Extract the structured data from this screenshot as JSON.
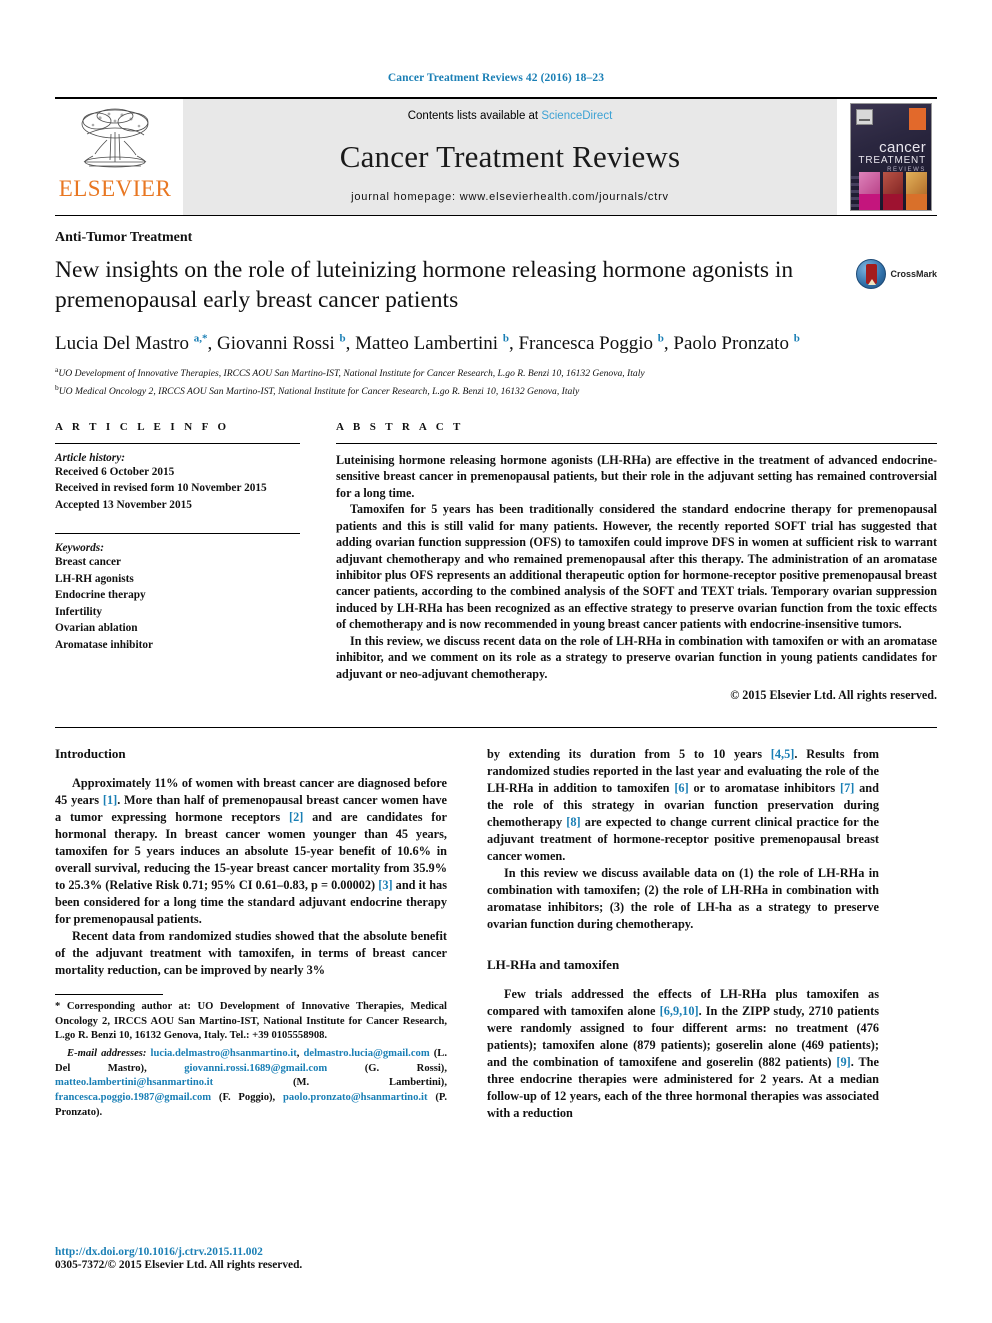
{
  "running_head": "Cancer Treatment Reviews 42 (2016) 18–23",
  "masthead": {
    "contents_prefix": "Contents lists available at ",
    "sciencedirect": "ScienceDirect",
    "journal_name": "Cancer Treatment Reviews",
    "homepage": "journal homepage: www.elsevierhealth.com/journals/ctrv",
    "publisher": "ELSEVIER",
    "cover": {
      "line1": "cancer",
      "line2": "TREATMENT",
      "line3": "REVIEWS"
    }
  },
  "article": {
    "category": "Anti-Tumor Treatment",
    "title": "New insights on the role of luteinizing hormone releasing hormone agonists in premenopausal early breast cancer patients",
    "crossmark_label": "CrossMark",
    "authors_html": "Lucia Del Mastro <sup>a,*</sup>, Giovanni Rossi <sup>b</sup>, Matteo Lambertini <sup>b</sup>, Francesca Poggio <sup>b</sup>, Paolo Pronzato <sup>b</sup>",
    "affiliations": [
      "UO Development of Innovative Therapies, IRCCS AOU San Martino-IST, National Institute for Cancer Research, L.go R. Benzi 10, 16132 Genova, Italy",
      "UO Medical Oncology 2, IRCCS AOU San Martino-IST, National Institute for Cancer Research, L.go R. Benzi 10, 16132 Genova, Italy"
    ],
    "affil_markers": [
      "a",
      "b"
    ]
  },
  "info": {
    "heading": "A R T I C L E    I N F O",
    "history_label": "Article history:",
    "history": [
      "Received 6 October 2015",
      "Received in revised form 10 November 2015",
      "Accepted 13 November 2015"
    ],
    "keywords_label": "Keywords:",
    "keywords": [
      "Breast cancer",
      "LH-RH agonists",
      "Endocrine therapy",
      "Infertility",
      "Ovarian ablation",
      "Aromatase inhibitor"
    ]
  },
  "abstract": {
    "heading": "A B S T R A C T",
    "paragraphs": [
      "Luteinising hormone releasing hormone agonists (LH-RHa) are effective in the treatment of advanced endocrine-sensitive breast cancer in premenopausal patients, but their role in the adjuvant setting has remained controversial for a long time.",
      "Tamoxifen for 5 years has been traditionally considered the standard endocrine therapy for premenopausal patients and this is still valid for many patients. However, the recently reported SOFT trial has suggested that adding ovarian function suppression (OFS) to tamoxifen could improve DFS in women at sufficient risk to warrant adjuvant chemotherapy and who remained premenopausal after this therapy. The administration of an aromatase inhibitor plus OFS represents an additional therapeutic option for hormone-receptor positive premenopausal breast cancer patients, according to the combined analysis of the SOFT and TEXT trials. Temporary ovarian suppression induced by LH-RHa has been recognized as an effective strategy to preserve ovarian function from the toxic effects of chemotherapy and is now recommended in young breast cancer patients with endocrine-insensitive tumors.",
      "In this review, we discuss recent data on the role of LH-RHa in combination with tamoxifen or with an aromatase inhibitor, and we comment on its role as a strategy to preserve ovarian function in young patients candidates for adjuvant or neo-adjuvant chemotherapy."
    ],
    "copyright": "© 2015 Elsevier Ltd. All rights reserved."
  },
  "body": {
    "left": {
      "intro_heading": "Introduction",
      "para1_html": "Approximately 11% of women with breast cancer are diagnosed before 45 years <span class=\"ref\">[1]</span>. More than half of premenopausal breast cancer women have a tumor expressing hormone receptors <span class=\"ref\">[2]</span> and are candidates for hormonal therapy. In breast cancer women younger than 45 years, tamoxifen for 5 years induces an absolute 15-year benefit of 10.6% in overall survival, reducing the 15-year breast cancer mortality from 35.9% to 25.3% (Relative Risk 0.71; 95% CI 0.61–0.83, p = 0.00002) <span class=\"ref\">[3]</span> and it has been considered for a long time the standard adjuvant endocrine therapy for premenopausal patients.",
      "para2_html": "Recent data from randomized studies showed that the absolute benefit of the adjuvant treatment with tamoxifen, in terms of breast cancer mortality reduction, can be improved by nearly 3%"
    },
    "right": {
      "para1_html": "by extending its duration from 5 to 10 years <span class=\"ref\">[4,5]</span>. Results from randomized studies reported in the last year and evaluating the role of the LH-RHa in addition to tamoxifen <span class=\"ref\">[6]</span> or to aromatase inhibitors <span class=\"ref\">[7]</span> and the role of this strategy in ovarian function preservation during chemotherapy <span class=\"ref\">[8]</span> are expected to change current clinical practice for the adjuvant treatment of hormone-receptor positive premenopausal breast cancer women.",
      "para2_html": "In this review we discuss available data on (1) the role of LH-RHa in combination with tamoxifen; (2) the role of LH-RHa in combination with aromatase inhibitors; (3) the role of LH-ha as a strategy to preserve ovarian function during chemotherapy.",
      "section_heading": "LH-RHa and tamoxifen",
      "para3_html": "Few trials addressed the effects of LH-RHa plus tamoxifen as compared with tamoxifen alone <span class=\"ref\">[6,9,10]</span>. In the ZIPP study, 2710 patients were randomly assigned to four different arms: no treatment (476 patients); tamoxifen alone (879 patients); goserelin alone (469 patients); and the combination of tamoxifene and goserelin (882 patients) <span class=\"ref\">[9]</span>. The three endocrine therapies were administered for 2 years. At a median follow-up of 12 years, each of the three hormonal therapies was associated with a reduction"
    }
  },
  "footnote": {
    "corresponding_html": "<span class=\"star\">*</span> Corresponding author at: UO Development of Innovative Therapies, Medical Oncology 2, IRCCS AOU San Martino-IST, National Institute for Cancer Research, L.go R. Benzi 10, 16132 Genova, Italy. Tel.: +39 0105558908.",
    "emails_html": "<em>E-mail addresses:</em> <span class=\"mail\">lucia.delmastro@hsanmartino.it</span>, <span class=\"mail\">delmastro.lucia@gmail.com</span> (L. Del Mastro), <span class=\"mail\">giovanni.rossi.1689@gmail.com</span> (G. Rossi), <span class=\"mail\">matteo.lambertini@hsanmartino.it</span> (M. Lambertini), <span class=\"mail\">francesca.poggio.1987@gmail.com</span> (F. Poggio), <span class=\"mail\">paolo.pronzato@hsanmartino.it</span> (P. Pronzato)."
  },
  "footer": {
    "doi": "http://dx.doi.org/10.1016/j.ctrv.2015.11.002",
    "issn_line": "0305-7372/© 2015 Elsevier Ltd. All rights reserved."
  },
  "colors": {
    "link": "#1a7fb5",
    "elsevier_orange": "#E87722",
    "sciencedirect": "#3da2d4"
  }
}
